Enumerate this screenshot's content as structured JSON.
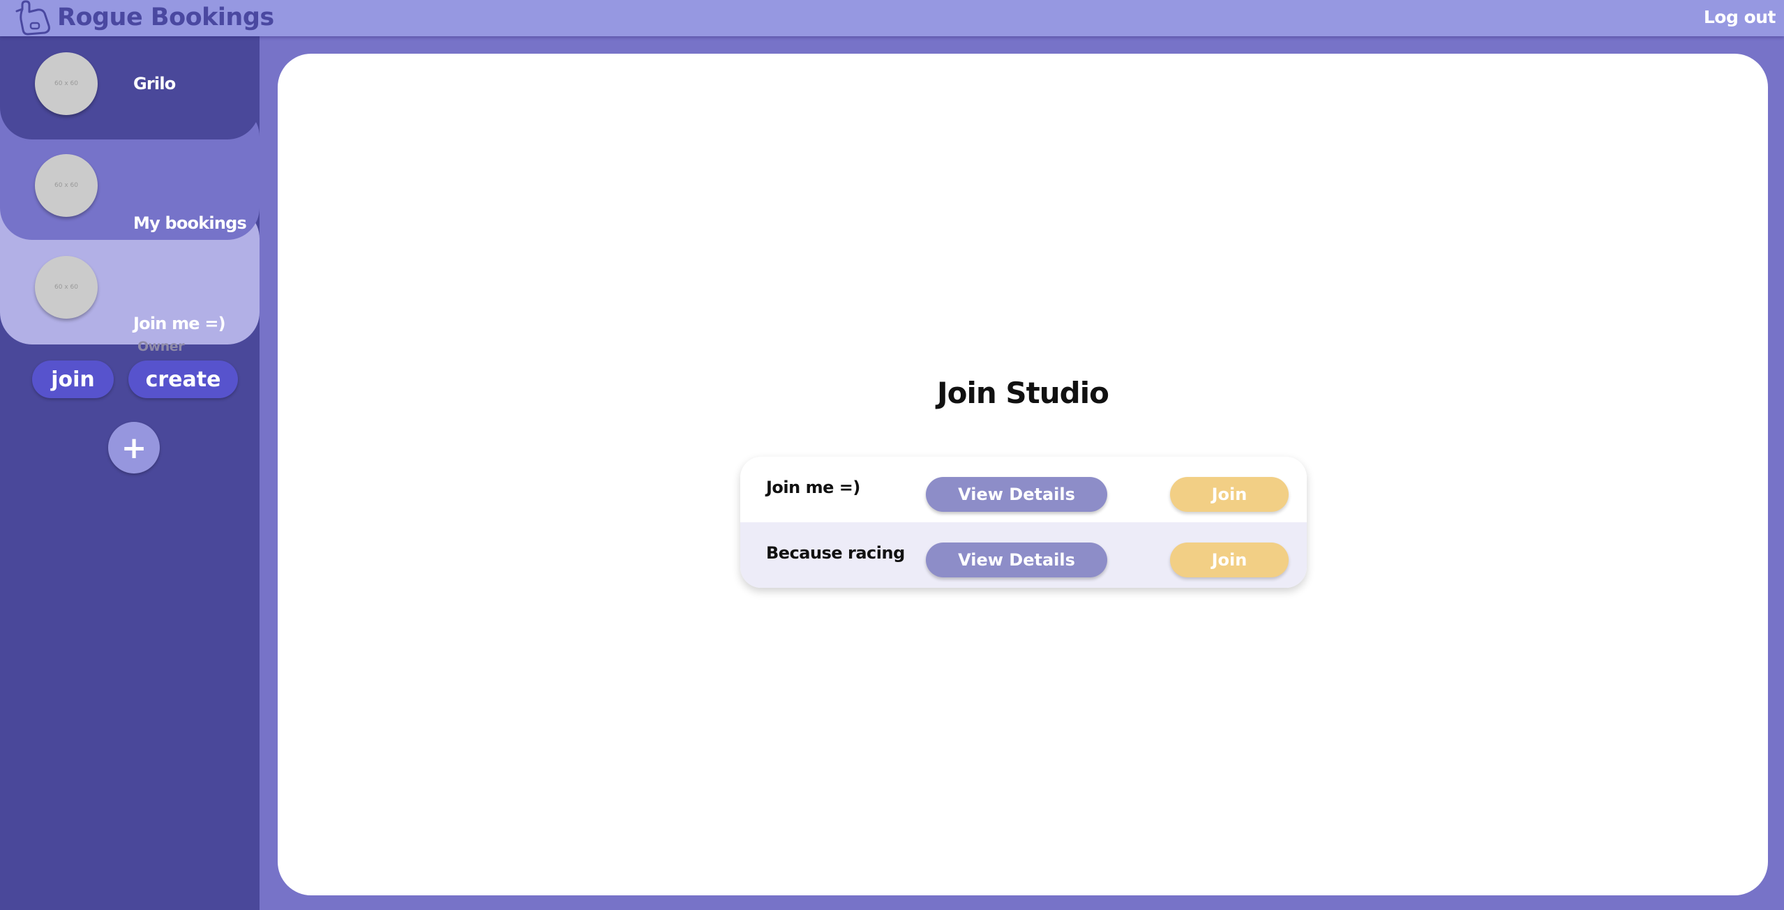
{
  "app": {
    "brand": "Rogue Bookings",
    "logo_icon": "hand-bell-icon",
    "logout_label": "Log out"
  },
  "sidebar": {
    "items": [
      {
        "label": "Grilo",
        "avatar_text": "60 x 60"
      },
      {
        "label": "My bookings",
        "avatar_text": "60 x 60"
      },
      {
        "label": "Join me =)",
        "sublabel": "Owner",
        "avatar_text": "60 x 60"
      }
    ],
    "join_label": "join",
    "create_label": "create",
    "add_label": "+"
  },
  "main": {
    "title": "Join Studio",
    "studios": [
      {
        "name": "Join me =)",
        "details_label": "View Details",
        "join_label": "Join"
      },
      {
        "name": "Because racing",
        "details_label": "View Details",
        "join_label": "Join"
      }
    ]
  },
  "colors": {
    "topbar": "#9698e1",
    "sidebar": "#4a489a",
    "page_background": "#7773c8",
    "selected_item": "#b2b0e6",
    "primary_button": "#5753cd",
    "details_button": "#8d8dc8",
    "join_button": "#f2cf85"
  }
}
